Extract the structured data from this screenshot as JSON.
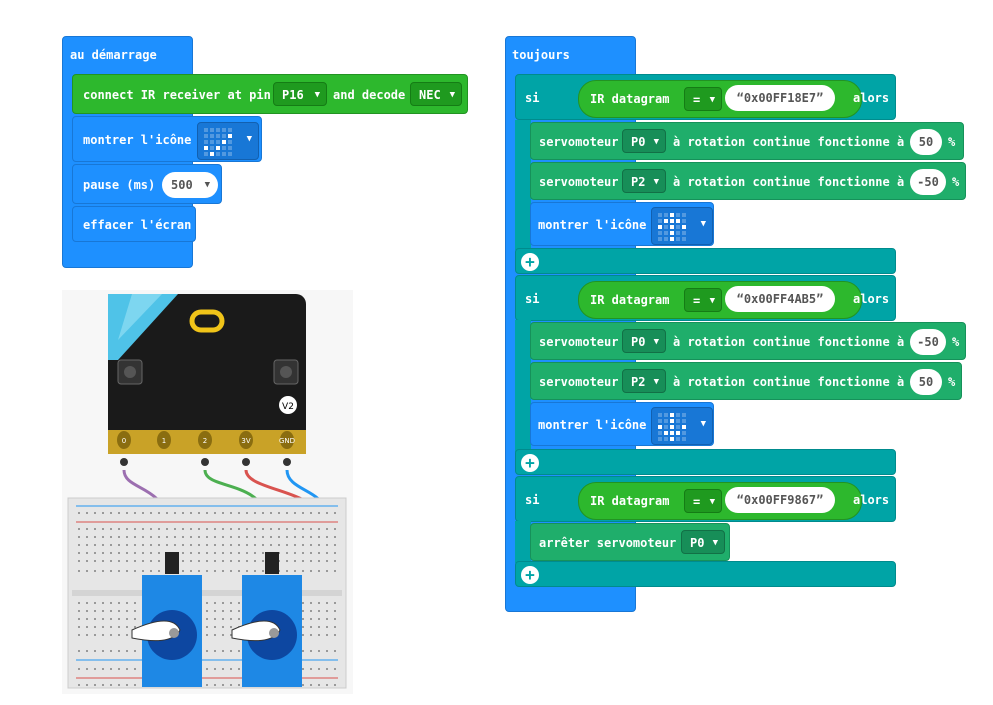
{
  "startup": {
    "title": "au démarrage",
    "ir_connect": {
      "prefix": "connect IR receiver at pin",
      "pin": "P16",
      "middle": "and decode",
      "protocol": "NEC"
    },
    "show_icon_label": "montrer l'icône",
    "pause_label": "pause (ms)",
    "pause_value": "500",
    "clear_label": "effacer l'écran"
  },
  "forever": {
    "title": "toujours",
    "if_label": "si",
    "then_label": "alors",
    "ir_datagram": "IR datagram",
    "equals": "=",
    "branches": [
      {
        "code": "0x00FF18E7",
        "servo1": {
          "label": "servomoteur",
          "pin": "P0",
          "text": "à rotation continue fonctionne à",
          "value": "50",
          "unit": "%"
        },
        "servo2": {
          "label": "servomoteur",
          "pin": "P2",
          "text": "à rotation continue fonctionne à",
          "value": "-50",
          "unit": "%"
        },
        "icon_label": "montrer l'icône"
      },
      {
        "code": "0x00FF4AB5",
        "servo1": {
          "label": "servomoteur",
          "pin": "P0",
          "text": "à rotation continue fonctionne à",
          "value": "-50",
          "unit": "%"
        },
        "servo2": {
          "label": "servomoteur",
          "pin": "P2",
          "text": "à rotation continue fonctionne à",
          "value": "50",
          "unit": "%"
        },
        "icon_label": "montrer l'icône"
      },
      {
        "code": "0x00FF9867",
        "stop": {
          "label": "arrêter servomoteur",
          "pin": "P0"
        }
      }
    ]
  },
  "microbit": {
    "pins": [
      "0",
      "1",
      "2",
      "3V",
      "GND"
    ],
    "version": "V2"
  },
  "colors": {
    "basic": "#1E90FF",
    "ir": "#2DB82D",
    "logic": "#00A4A6",
    "servo": "#1FAE6B"
  }
}
